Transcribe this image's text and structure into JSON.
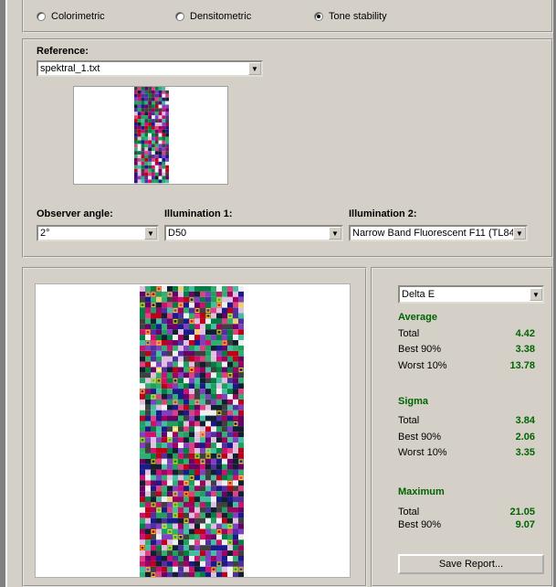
{
  "mode": {
    "options": [
      {
        "label": "Colorimetric",
        "selected": false
      },
      {
        "label": "Densitometric",
        "selected": false
      },
      {
        "label": "Tone stability",
        "selected": true
      }
    ]
  },
  "reference": {
    "label": "Reference:",
    "file": "spektral_1.txt"
  },
  "observer": {
    "label": "Observer angle:",
    "value": "2°"
  },
  "illumination1": {
    "label": "Illumination 1:",
    "value": "D50"
  },
  "illumination2": {
    "label": "Illumination 2:",
    "value": "Narrow Band Fluorescent F11 (TL84)"
  },
  "metric": {
    "value": "Delta E"
  },
  "stats": {
    "average": {
      "title": "Average",
      "rows": [
        {
          "label": "Total",
          "value": "4.42"
        },
        {
          "label": "Best 90%",
          "value": "3.38"
        },
        {
          "label": "Worst 10%",
          "value": "13.78"
        }
      ]
    },
    "sigma": {
      "title": "Sigma",
      "rows": [
        {
          "label": "Total",
          "value": "3.84"
        },
        {
          "label": "Best 90%",
          "value": "2.06"
        },
        {
          "label": "Worst 10%",
          "value": "3.35"
        }
      ]
    },
    "maximum": {
      "title": "Maximum",
      "rows": [
        {
          "label": "Total",
          "value": "21.05"
        },
        {
          "label": "Best 90%",
          "value": "9.07"
        }
      ]
    }
  },
  "save_button": "Save Report...",
  "colors": {
    "stat_green": "#006400",
    "face": "#d4d0c8",
    "marker_yellow": "#ffe000"
  }
}
